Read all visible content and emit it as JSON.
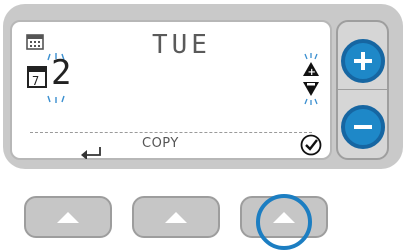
{
  "screen": {
    "day": "TUE",
    "day_number": "2",
    "action_text": "COPY"
  },
  "icons": {
    "calendar": "calendar-icon",
    "copy_day": "copy-day-calendar-icon",
    "back": "back-arrow-icon",
    "up_down": "up-down-arrows-icon",
    "confirm": "checkmark-icon",
    "plus": "plus-icon",
    "minus": "minus-icon",
    "up": "up-triangle-icon"
  },
  "colors": {
    "accent": "#1e88c8",
    "accent_border": "#1666a2",
    "bezel": "#c9c9c9"
  }
}
